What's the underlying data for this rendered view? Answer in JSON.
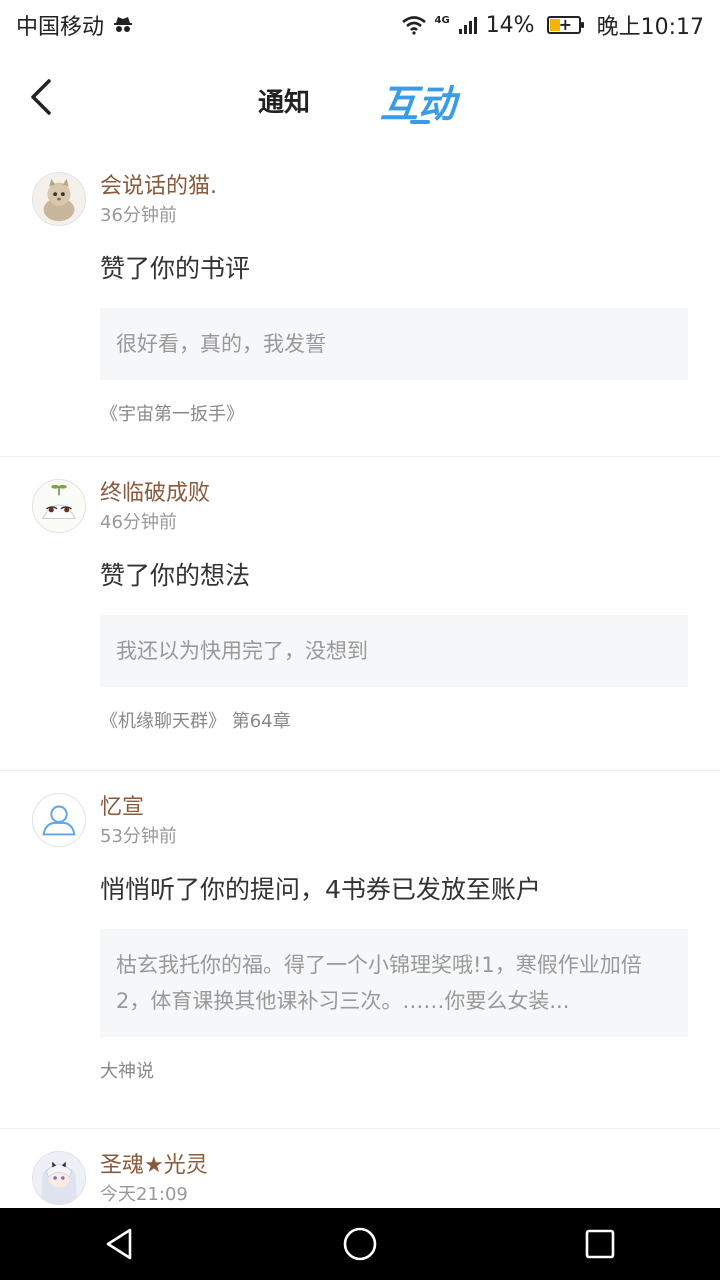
{
  "status": {
    "carrier": "中国移动",
    "network": "4G",
    "battery": "14%",
    "time": "晚上10:17"
  },
  "header": {
    "tab_notify": "通知",
    "tab_interact": "互动"
  },
  "items": [
    {
      "name": "会说话的猫.",
      "time": "36分钟前",
      "action": "赞了你的书评",
      "quote": "很好看，真的，我发誓",
      "source": "《宇宙第一扳手》"
    },
    {
      "name": "终临破成败",
      "time": "46分钟前",
      "action": "赞了你的想法",
      "quote": "我还以为快用完了，没想到",
      "source": "《机缘聊天群》 第64章"
    },
    {
      "name": "忆宣",
      "time": "53分钟前",
      "action": "悄悄听了你的提问，4书券已发放至账户",
      "quote": "枯玄我托你的福。得了一个小锦理奖哦!1，寒假作业加倍2，体育课换其他课补习三次。……你要么女装...",
      "source": "大神说"
    },
    {
      "name": "圣魂★光灵",
      "time": "今天21:09"
    }
  ],
  "colors": {
    "accent": "#3a9be6",
    "username": "#8a5a3c"
  },
  "icons": {
    "back": "chevron-left-icon",
    "wifi": "wifi-icon",
    "signal": "signal-icon",
    "battery": "battery-charging-icon",
    "nav_back": "triangle-back-icon",
    "nav_home": "circle-home-icon",
    "nav_recent": "square-recent-icon"
  }
}
